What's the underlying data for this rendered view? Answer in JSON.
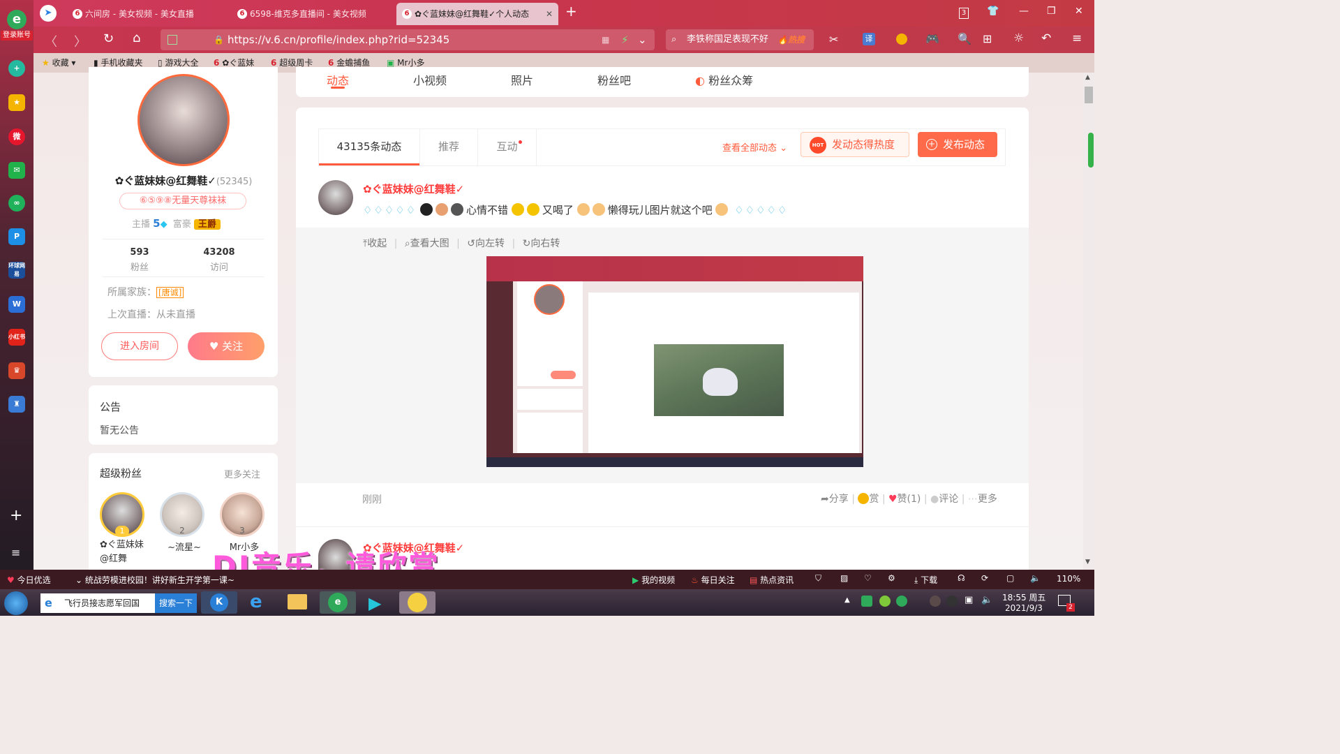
{
  "browser": {
    "tabs": [
      {
        "label": "六间房 - 美女视频 - 美女直播"
      },
      {
        "label": "6598-维克多直播间 - 美女视频"
      },
      {
        "label": "✿ぐ蓝妹妹@红舞鞋✓个人动态"
      }
    ],
    "login_label": "登录账号",
    "url": "https://v.6.cn/profile/index.php?rid=52345",
    "search_text": "李铁称国足表现不好",
    "search_badge": "🔥热搜",
    "tab_count": "3",
    "translate_label": "译"
  },
  "bookmarks": [
    "收藏",
    "手机收藏夹",
    "游戏大全",
    "✿ぐ蓝妹",
    "超级周卡",
    "金蟾捕鱼",
    "Mr小多"
  ],
  "sidebar_icons": [
    "add",
    "star",
    "weibo",
    "mail",
    "chain",
    "pp",
    "news",
    "doc",
    "hongbao",
    "game1",
    "game2",
    "plus",
    "list"
  ],
  "sidebar_labels": {
    "news": "环球网易",
    "hongbao": "小红书"
  },
  "profile_tabs": [
    "动态",
    "小视频",
    "照片",
    "粉丝吧",
    "粉丝众筹"
  ],
  "profile": {
    "name": "✿ぐ蓝妹妹@红舞鞋✓",
    "rid": "(52345)",
    "badge": "⑥⑤⑨⑧无量天尊袜袜",
    "anchor_label": "主播",
    "anchor_level": "5",
    "rich_label": "富豪",
    "rich_title": "王爵",
    "fans_count": "593",
    "fans_label": "粉丝",
    "visits_count": "43208",
    "visits_label": "访问",
    "family_label": "所属家族：",
    "family_name": "[唐诚]",
    "last_live": "上次直播：从未直播",
    "enter_room": "进入房间",
    "follow": "关注"
  },
  "notice": {
    "title": "公告",
    "text": "暂无公告"
  },
  "superfans": {
    "title": "超级粉丝",
    "more": "更多关注",
    "fans": [
      {
        "rank": "1",
        "name": "✿ぐ蓝妹妹@红舞"
      },
      {
        "rank": "2",
        "name": "~流星~"
      },
      {
        "rank": "3",
        "name": "Mr小多"
      }
    ]
  },
  "feed": {
    "tabs": [
      "43135条动态",
      "推荐",
      "互动"
    ],
    "view_all": "查看全部动态",
    "hot_btn": "发动态得热度",
    "hot_tag": "HOT",
    "publish_btn": "发布动态",
    "post": {
      "author": "✿ぐ蓝妹妹@红舞鞋✓",
      "text_segments": [
        "心情不错",
        "又喝了",
        "懒得玩儿图片就这个吧"
      ],
      "tools": [
        "收起",
        "查看大图",
        "向左转",
        "向右转"
      ],
      "time": "刚刚",
      "actions": [
        "分享",
        "赏",
        "赞(1)",
        "评论",
        "更多"
      ]
    },
    "next_author": "✿ぐ蓝妹妹@红舞鞋✓"
  },
  "overlay_text": "DJ音乐，请欣赏",
  "statusbar": {
    "left": "今日优选",
    "news": "统战劳模进校园！讲好新生开学第一课~",
    "my_video": "我的视频",
    "daily": "每日关注",
    "hot_news": "热点资讯",
    "download": "下载",
    "zoom": "110%"
  },
  "taskbar": {
    "search_text": "飞行员接志愿军回国",
    "search_btn": "搜索一下",
    "time": "18:55 周五",
    "date": "2021/9/3",
    "notif": "2"
  },
  "colors": {
    "accent": "#ff5a3c",
    "brand_red": "#d8222f",
    "pink": "#ff7a8a"
  }
}
